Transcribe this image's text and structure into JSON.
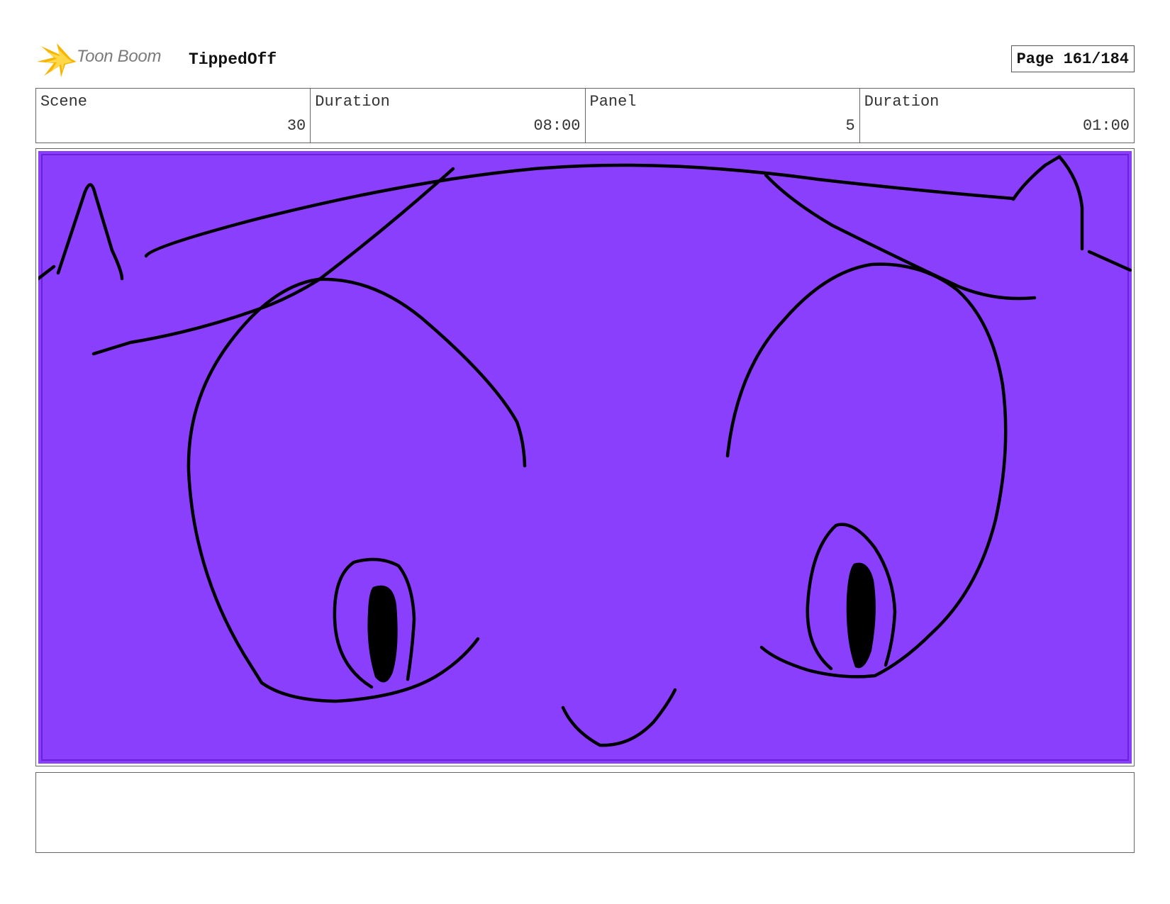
{
  "header": {
    "logo_text": "Toon Boom",
    "project_title": "TippedOff",
    "page_label": "Page 161/184"
  },
  "info": {
    "scene_label": "Scene",
    "scene_value": "30",
    "scene_duration_label": "Duration",
    "scene_duration_value": "08:00",
    "panel_label": "Panel",
    "panel_value": "5",
    "panel_duration_label": "Duration",
    "panel_duration_value": "01:00"
  },
  "panel": {
    "background_color": "#8a3ffc",
    "line_color": "#000000",
    "description": ""
  },
  "notes": {
    "text": ""
  }
}
